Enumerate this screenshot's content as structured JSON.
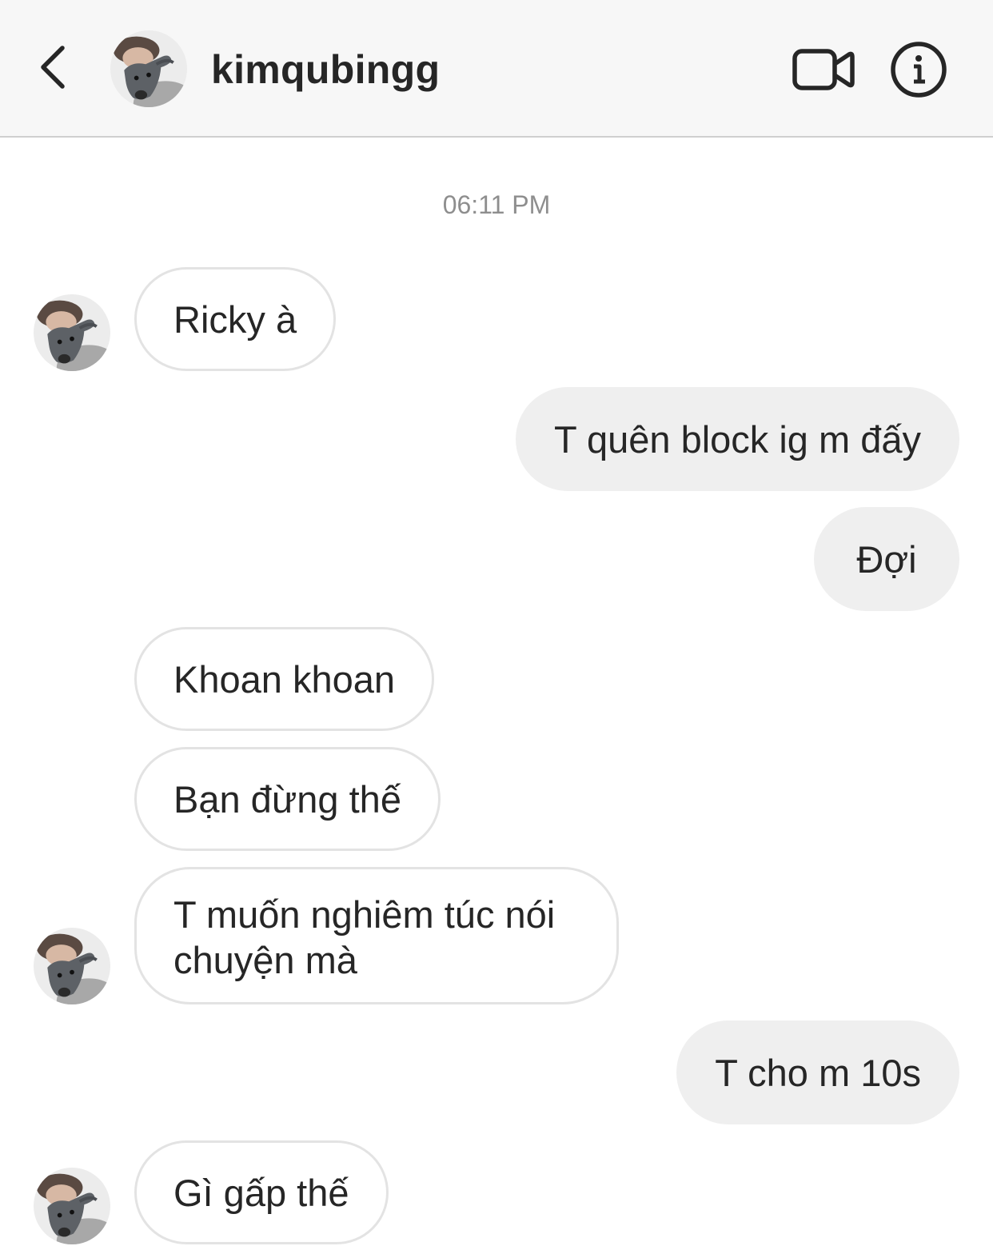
{
  "header": {
    "username": "kimqubingg",
    "icons": {
      "back": "chevron-left-icon",
      "video": "video-camera-icon",
      "info": "info-icon"
    }
  },
  "chat": {
    "timestamp": "06:11 PM",
    "messages": [
      {
        "from": "them",
        "text": "Ricky à"
      },
      {
        "from": "me",
        "text": "T quên block ig m đấy"
      },
      {
        "from": "me",
        "text": "Đợi"
      },
      {
        "from": "them",
        "text": "Khoan khoan"
      },
      {
        "from": "them",
        "text": "Bạn đừng thế"
      },
      {
        "from": "them",
        "text": "T muốn nghiêm túc nói chuyện mà"
      },
      {
        "from": "me",
        "text": "T cho m 10s"
      },
      {
        "from": "them",
        "text": "Gì gấp thế"
      }
    ]
  },
  "colors": {
    "header_bg": "#f7f7f7",
    "outgoing_bubble": "#efefef",
    "incoming_border": "#e3e3e3",
    "text": "#262626",
    "timestamp": "#8e8e8e"
  }
}
